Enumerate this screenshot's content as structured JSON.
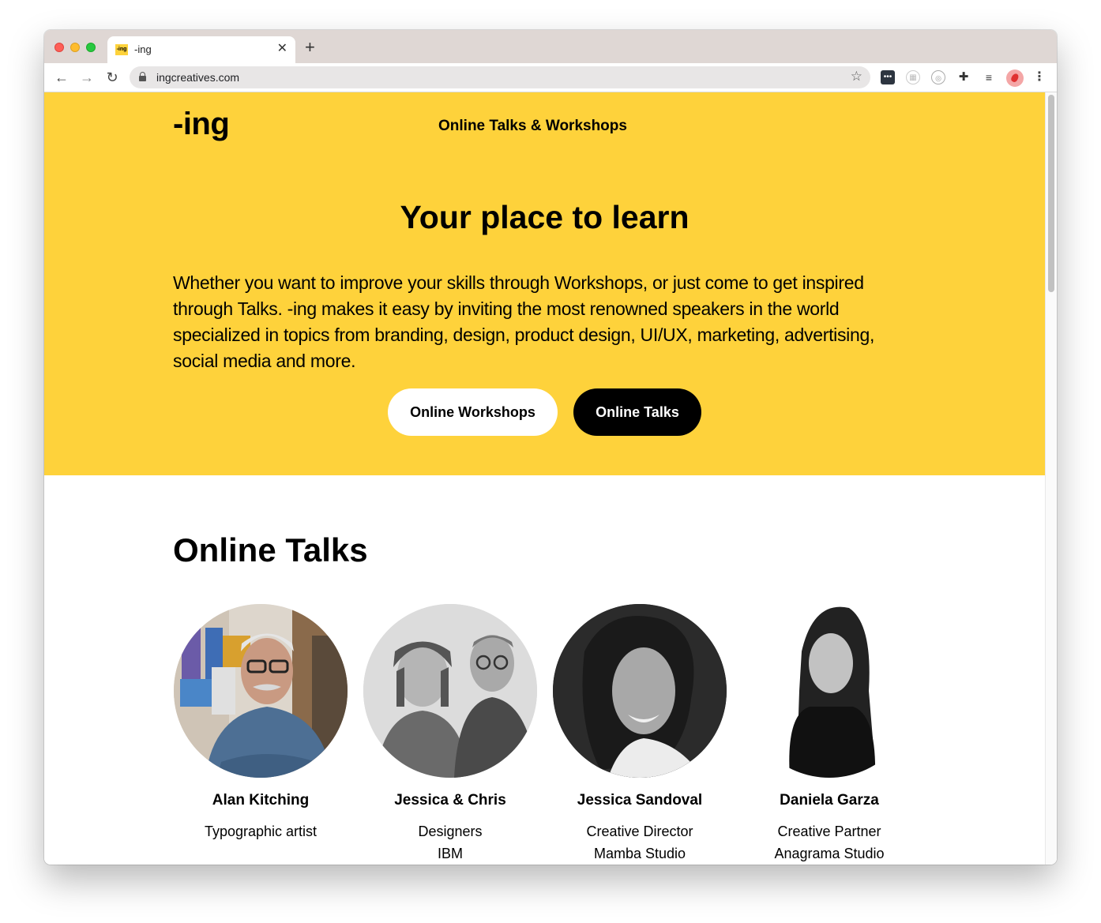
{
  "browser": {
    "tab_title": "-ing",
    "favicon_text": "-ing",
    "tab_close": "✕",
    "new_tab": "+",
    "url": "ingcreatives.com",
    "nav_back": "←",
    "nav_forward": "→",
    "nav_reload": "↻",
    "star": "☆",
    "menu": "⋮"
  },
  "header": {
    "logo": "-ing",
    "nav_link": "Online Talks & Workshops"
  },
  "hero": {
    "title": "Your place to learn",
    "description": "Whether you want to improve your skills through Workshops, or just come to get inspired through Talks. -ing makes it easy by inviting the most renowned speakers in the world specialized in topics from branding, design, product design, UI/UX, marketing, advertising, social media and more.",
    "buttons": {
      "workshops": "Online Workshops",
      "talks": "Online Talks"
    }
  },
  "talks": {
    "title": "Online Talks",
    "speakers": [
      {
        "name": "Alan Kitching",
        "role": "Typographic artist",
        "company": ""
      },
      {
        "name": "Jessica & Chris",
        "role": "Designers",
        "company": "IBM"
      },
      {
        "name": "Jessica Sandoval",
        "role": "Creative Director",
        "company": "Mamba Studio"
      },
      {
        "name": "Daniela Garza",
        "role": "Creative Partner",
        "company": "Anagrama Studio"
      }
    ]
  },
  "colors": {
    "hero_bg": "#fed23b",
    "primary_text": "#000000",
    "button_light": "#ffffff",
    "button_dark": "#000000"
  }
}
